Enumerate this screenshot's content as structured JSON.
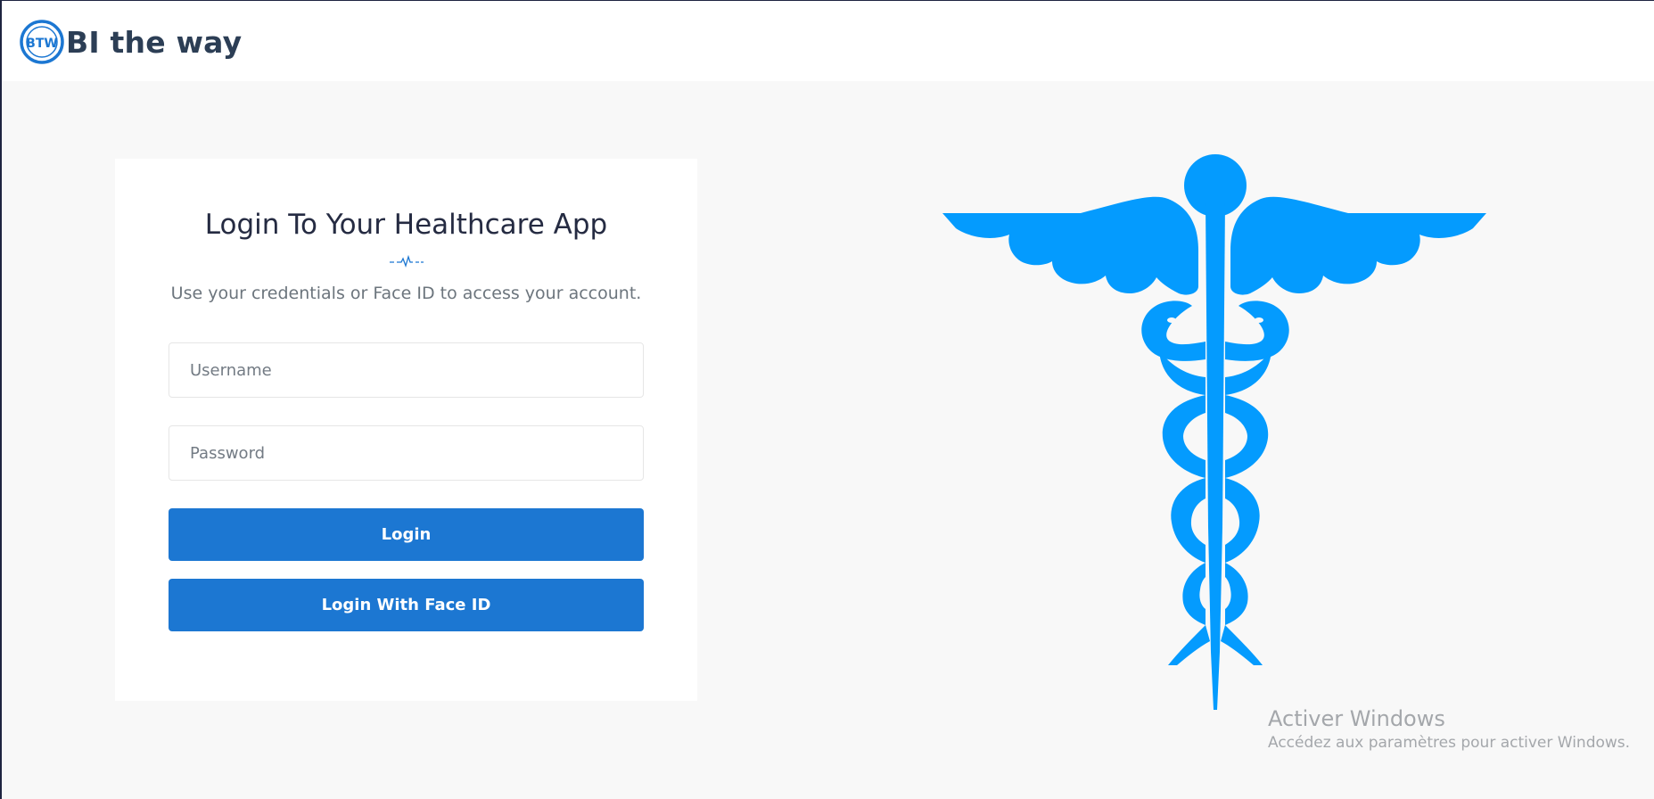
{
  "header": {
    "logo_icon": "btw-logo",
    "logo_text": "BTW",
    "app_name": "BI the way"
  },
  "login": {
    "title": "Login To Your Healthcare App",
    "divider_icon": "heartbeat-icon",
    "subtitle": "Use your credentials or Face ID to access your account.",
    "username_placeholder": "Username",
    "username_value": "",
    "password_placeholder": "Password",
    "password_value": "",
    "login_label": "Login",
    "faceid_label": "Login With Face ID"
  },
  "illustration": {
    "icon": "caduceus-icon",
    "color": "#049bfe"
  },
  "watermark": {
    "title": "Activer Windows",
    "subtitle": "Accédez aux paramètres pour activer Windows."
  },
  "colors": {
    "brand_blue": "#1c77d2",
    "caduceus_blue": "#049bfe",
    "background": "#f8f8f8",
    "title_text": "#252b42"
  }
}
